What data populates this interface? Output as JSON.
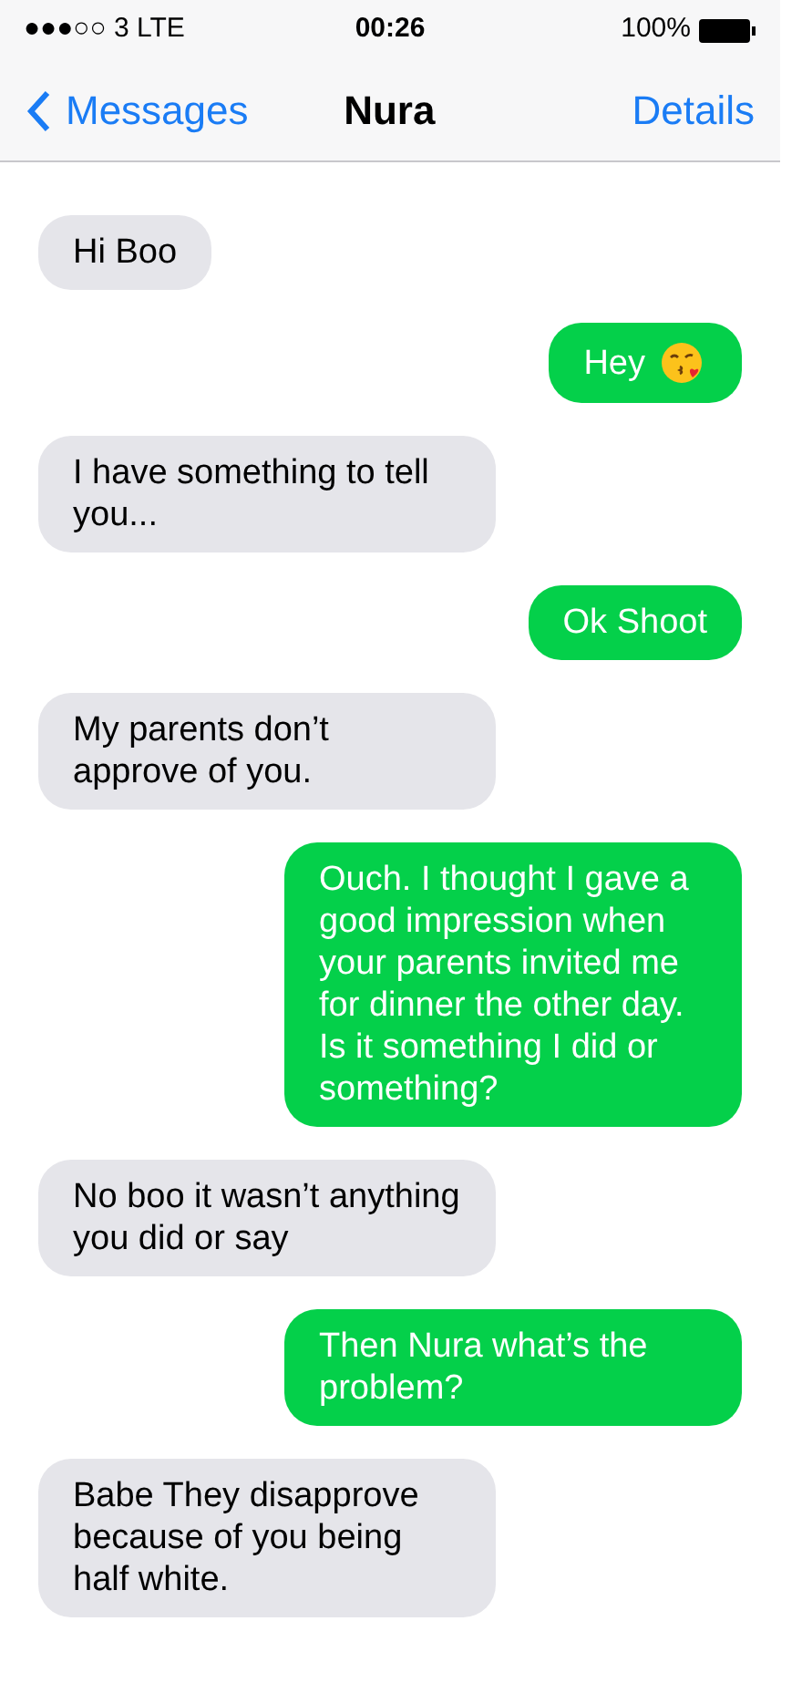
{
  "status_bar": {
    "carrier": "●●●○○ 3  LTE",
    "time": "00:26",
    "battery": "100%"
  },
  "nav": {
    "back": "Messages",
    "title": "Nura",
    "action": "Details"
  },
  "messages": [
    {
      "kind": "incoming",
      "text": "Hi Boo",
      "has_emoji": false
    },
    {
      "kind": "outgoing",
      "text": "Hey",
      "has_emoji": true
    },
    {
      "kind": "incoming",
      "text": "I have something to tell you...",
      "has_emoji": false
    },
    {
      "kind": "outgoing",
      "text": "Ok Shoot",
      "has_emoji": false
    },
    {
      "kind": "incoming",
      "text": "My parents don’t approve of you.",
      "has_emoji": false
    },
    {
      "kind": "outgoing",
      "text": "Ouch. I thought I gave a good impression when your parents invited me for dinner the other day. Is it something I did or something?",
      "has_emoji": false
    },
    {
      "kind": "incoming",
      "text": "No boo it wasn’t anything you did or say",
      "has_emoji": false
    },
    {
      "kind": "outgoing",
      "text": "Then Nura what’s the problem?",
      "has_emoji": false
    },
    {
      "kind": "incoming",
      "text": "Babe They disapprove because of you being half white.",
      "has_emoji": false
    }
  ]
}
